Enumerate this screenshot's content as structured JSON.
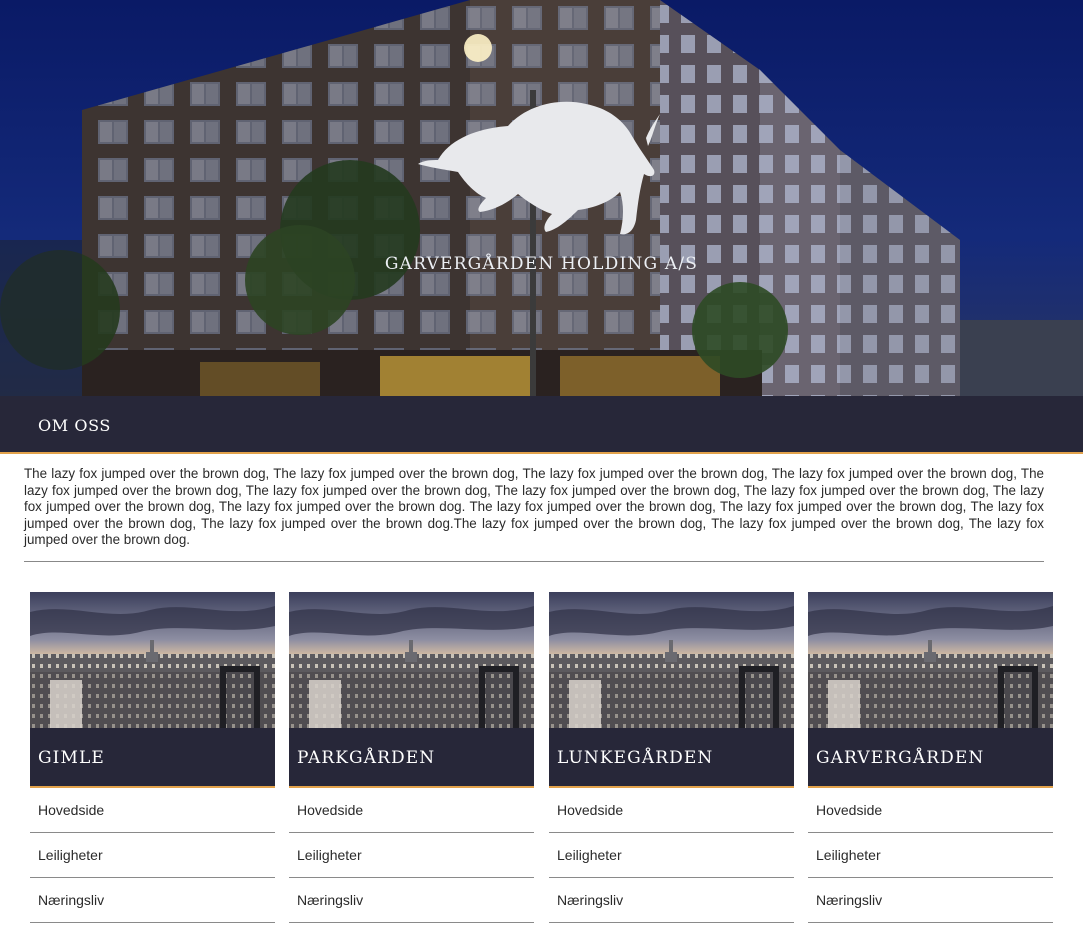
{
  "hero": {
    "brand": "GARVERGÅRDEN HOLDING A/S",
    "logo_icon": "bull-icon"
  },
  "about": {
    "title": "OM OSS",
    "text": "The lazy fox jumped over the brown dog, The lazy fox jumped over the brown dog, The lazy fox jumped over the brown dog, The lazy fox jumped over the brown dog, The lazy fox jumped over the brown dog, The lazy fox jumped over the brown dog, The lazy fox jumped over the brown dog, The lazy fox jumped over the brown dog, The lazy fox jumped over the brown dog, The lazy fox  jumped over the brown dog. The lazy fox jumped over the brown dog, The lazy fox jumped over the brown dog, The lazy fox jumped over the brown dog, The lazy fox  jumped over the brown dog.The lazy fox jumped over the brown dog, The lazy fox jumped over the brown dog, The lazy fox jumped over the brown dog."
  },
  "colors": {
    "navy": "#272739",
    "accent": "#e2a24b"
  },
  "cards": [
    {
      "title": "GIMLE",
      "links": [
        "Hovedside",
        "Leiligheter",
        "Næringsliv"
      ]
    },
    {
      "title": "PARKGÅRDEN",
      "links": [
        "Hovedside",
        "Leiligheter",
        "Næringsliv"
      ]
    },
    {
      "title": "LUNKEGÅRDEN",
      "links": [
        "Hovedside",
        "Leiligheter",
        "Næringsliv"
      ]
    },
    {
      "title": "GARVERGÅRDEN",
      "links": [
        "Hovedside",
        "Leiligheter",
        "Næringsliv"
      ]
    }
  ]
}
